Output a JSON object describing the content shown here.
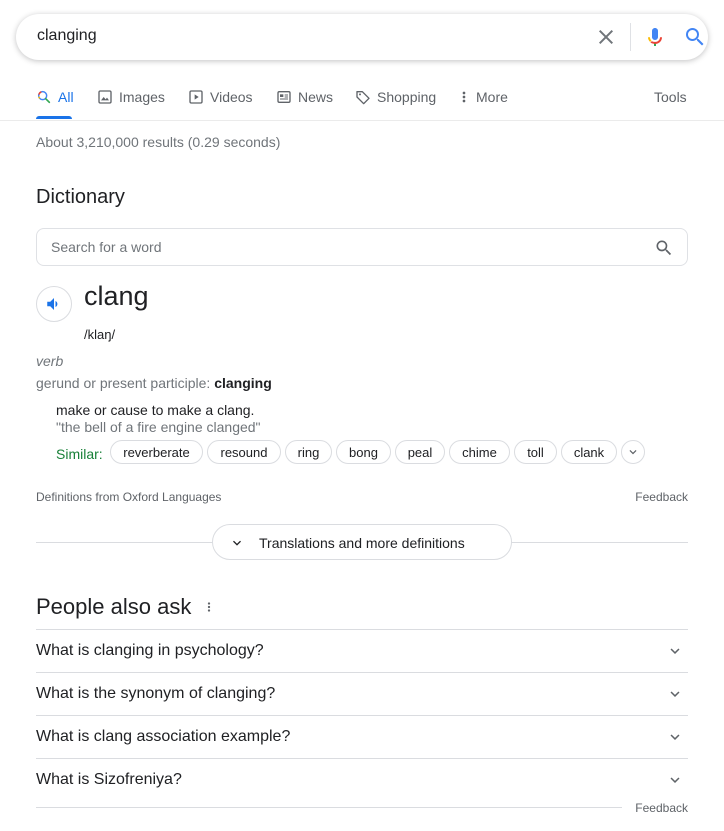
{
  "search": {
    "query": "clanging"
  },
  "tabs": [
    {
      "label": "All",
      "icon": "search-icon",
      "active": true
    },
    {
      "label": "Images",
      "icon": "image-icon"
    },
    {
      "label": "Videos",
      "icon": "video-icon"
    },
    {
      "label": "News",
      "icon": "news-icon"
    },
    {
      "label": "Shopping",
      "icon": "tag-icon"
    },
    {
      "label": "More",
      "icon": "more-vert-icon"
    }
  ],
  "tools_label": "Tools",
  "result_stats": "About 3,210,000 results (0.29 seconds)",
  "dictionary": {
    "heading": "Dictionary",
    "search_placeholder": "Search for a word",
    "word": "clang",
    "phonetic": "/klaŋ/",
    "part_of_speech": "verb",
    "gerund_label": "gerund or present participle:",
    "gerund_value": "clanging",
    "definition": "make or cause to make a clang.",
    "example": "\"the bell of a fire engine clanged\"",
    "similar_label": "Similar:",
    "similar": [
      "reverberate",
      "resound",
      "ring",
      "bong",
      "peal",
      "chime",
      "toll",
      "clank"
    ],
    "source": "Definitions from Oxford Languages",
    "feedback": "Feedback",
    "translations_button": "Translations and more definitions"
  },
  "people_also_ask": {
    "heading": "People also ask",
    "questions": [
      "What is clanging in psychology?",
      "What is the synonym of clanging?",
      "What is clang association example?",
      "What is Sizofreniya?"
    ],
    "feedback": "Feedback"
  },
  "colors": {
    "accent": "#1a73e8",
    "similar_green": "#188038",
    "text": "#202124",
    "muted": "#70757a"
  }
}
